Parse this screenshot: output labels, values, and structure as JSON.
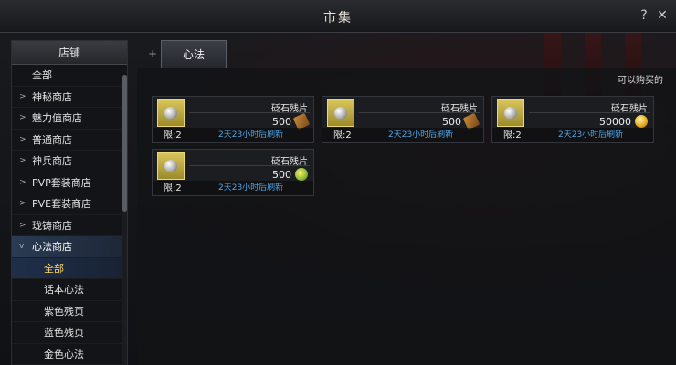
{
  "window": {
    "title": "市集",
    "help_label": "?",
    "close_label": "✕"
  },
  "sidebar": {
    "header": "店铺",
    "items": [
      {
        "label": "全部",
        "chev": ""
      },
      {
        "label": "神秘商店",
        "chev": ">"
      },
      {
        "label": "魅力值商店",
        "chev": ">"
      },
      {
        "label": "普通商店",
        "chev": ">"
      },
      {
        "label": "神兵商店",
        "chev": ">"
      },
      {
        "label": "PVP套装商店",
        "chev": ">"
      },
      {
        "label": "PVE套装商店",
        "chev": ">"
      },
      {
        "label": "珑铸商店",
        "chev": ">"
      },
      {
        "label": "心法商店",
        "chev": "v"
      }
    ],
    "subitems": [
      {
        "label": "全部"
      },
      {
        "label": "话本心法"
      },
      {
        "label": "紫色残页"
      },
      {
        "label": "蓝色残页"
      },
      {
        "label": "金色心法"
      }
    ]
  },
  "tabs": {
    "active_label": "心法",
    "add_label": "+"
  },
  "filter": {
    "label": "可以购买的"
  },
  "items": [
    {
      "name": "砭石残片",
      "price": "500",
      "currency": "scroll-currency-icon",
      "limit": "限:2",
      "refresh": "2天23小时后刷新"
    },
    {
      "name": "砭石残片",
      "price": "500",
      "currency": "scroll-currency-icon",
      "limit": "限:2",
      "refresh": "2天23小时后刷新"
    },
    {
      "name": "砭石残片",
      "price": "50000",
      "currency": "gold-coin-icon",
      "limit": "限:2",
      "refresh": "2天23小时后刷新"
    },
    {
      "name": "砭石残片",
      "price": "500",
      "currency": "leaf-currency-icon",
      "limit": "限:2",
      "refresh": "2天23小时后刷新"
    }
  ],
  "colors": {
    "refresh_text": "#4fa5e8",
    "selected_sub": "#ffd76a",
    "icon_frame": "#d8c45a"
  }
}
